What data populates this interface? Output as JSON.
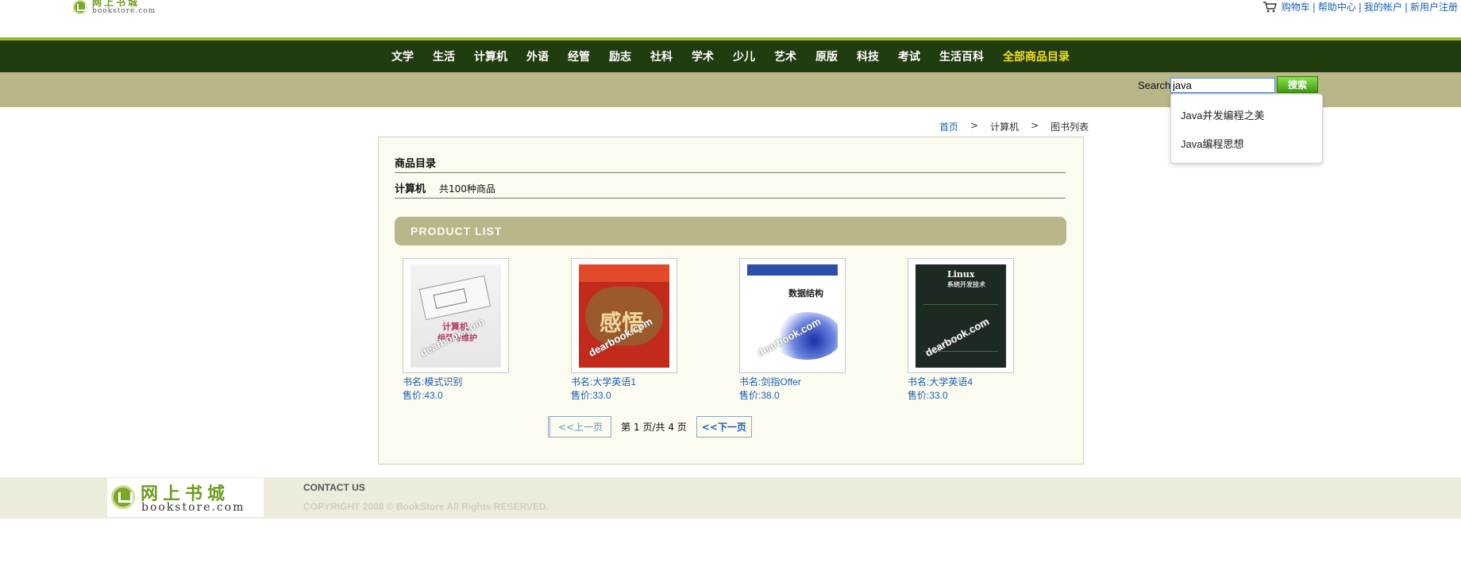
{
  "header": {
    "logo_cn": "网上书城",
    "logo_en": "bookstore.com",
    "links": [
      "购物车",
      "帮助中心",
      "我的帐户",
      "新用户注册"
    ],
    "link_separator": "|"
  },
  "nav": {
    "items": [
      "文学",
      "生活",
      "计算机",
      "外语",
      "经管",
      "励志",
      "社科",
      "学术",
      "少儿",
      "艺术",
      "原版",
      "科技",
      "考试",
      "生活百科"
    ],
    "all_label": "全部商品目录"
  },
  "search": {
    "label": "Search",
    "value": "java",
    "button": "搜索",
    "suggestions": [
      "Java并发编程之美",
      "Java编程思想"
    ]
  },
  "breadcrumb": {
    "home": "首页",
    "separator": ">",
    "category": "计算机",
    "current": "图书列表"
  },
  "panel": {
    "title": "商品目录",
    "category": "计算机",
    "count_text": "共100种商品",
    "product_list_label": "PRODUCT LIST"
  },
  "books": [
    {
      "name": "书名:模式识别",
      "price": "售价:43.0"
    },
    {
      "name": "书名:大学英语1",
      "price": "售价:33.0"
    },
    {
      "name": "书名:剑指Offer",
      "price": "售价:38.0"
    },
    {
      "name": "书名:大学英语4",
      "price": "售价:33.0"
    }
  ],
  "pager": {
    "prev": "<<上一页",
    "info_prefix": "第",
    "current_page": "1",
    "info_mid": "页/共",
    "total_pages": "4",
    "info_suffix": "页",
    "next": "<<下一页"
  },
  "footer": {
    "logo_cn": "网上书城",
    "logo_en": "bookstore.com",
    "contact": "CONTACT US",
    "copyright": "COPYRIGHT 2008 © BookStore All Rights RESERVED."
  },
  "colors": {
    "nav_bg": "#213c0e",
    "nav_accent": "#9ab82c",
    "band": "#b9b689",
    "all_items": "#f3e11a",
    "link": "#1a5fb4",
    "panel_bg": "#fbfbef",
    "footer_bg": "#edecdc"
  },
  "icons": {
    "cart": "cart-icon",
    "logo": "bookstore-logo-icon"
  }
}
